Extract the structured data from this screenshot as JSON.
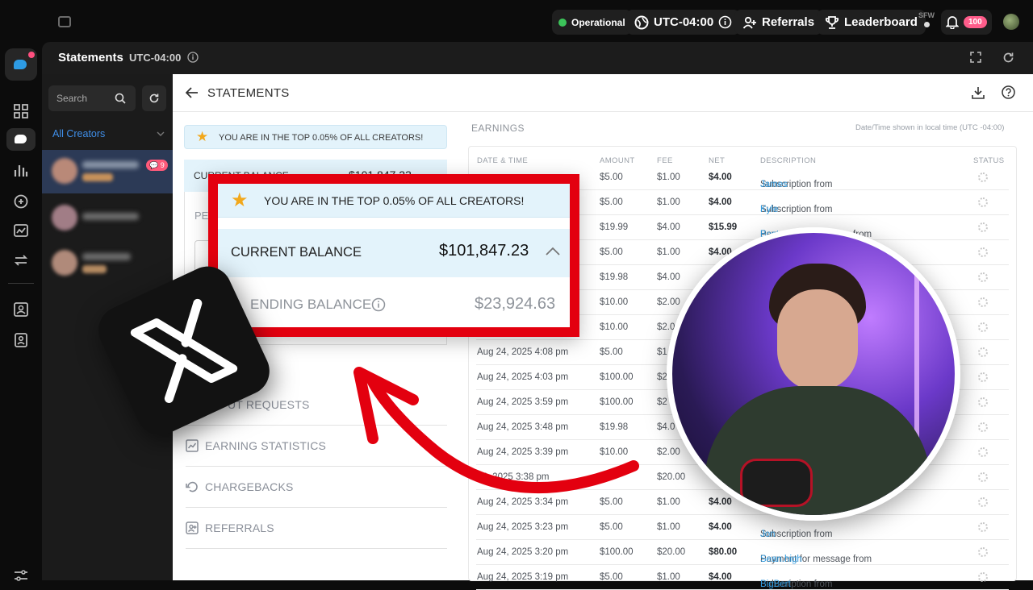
{
  "topbar": {
    "status": "Operational",
    "timezone": "UTC-04:00",
    "referrals": "Referrals",
    "leaderboard": "Leaderboard",
    "sfw": "SFW",
    "notif_count": "100"
  },
  "subheader": {
    "title": "Statements",
    "timezone": "UTC-04:00"
  },
  "creators": {
    "search_placeholder": "Search",
    "filter": "All Creators",
    "badge": "9"
  },
  "main": {
    "title": "STATEMENTS",
    "top_banner": "YOU ARE IN THE TOP 0.05% OF ALL CREATORS!",
    "current_balance_label": "CURRENT BALANCE",
    "current_balance_value": "$101,847.23",
    "pending_balance_label_partial": "PE",
    "menu": {
      "payout": "UT REQUESTS",
      "earning_stats": "EARNING STATISTICS",
      "chargebacks": "CHARGEBACKS",
      "referrals": "REFERRALS"
    }
  },
  "earnings": {
    "title": "EARNINGS",
    "note": "Date/Time shown in local time (UTC -04:00)",
    "columns": [
      "DATE & TIME",
      "AMOUNT",
      "FEE",
      "NET",
      "DESCRIPTION",
      "STATUS"
    ],
    "rows": [
      {
        "date": "",
        "amount": "$5.00",
        "fee": "$1.00",
        "net": "$4.00",
        "desc": "Subscription from ",
        "who": "James"
      },
      {
        "date": "",
        "amount": "$5.00",
        "fee": "$1.00",
        "net": "$4.00",
        "desc": "Subscription from ",
        "who": "Kyle"
      },
      {
        "date": "",
        "amount": "$19.99",
        "fee": "$4.00",
        "net": "$15.99",
        "desc": "Payment for message from ",
        "who": "Boston-guy69"
      },
      {
        "date": "",
        "amount": "$5.00",
        "fee": "$1.00",
        "net": "$4.00",
        "desc": "",
        "who": ""
      },
      {
        "date": "",
        "amount": "$19.98",
        "fee": "$4.00",
        "net": "",
        "desc": "",
        "who": ""
      },
      {
        "date": "",
        "amount": "$10.00",
        "fee": "$2.00",
        "net": "",
        "desc": "",
        "who": ""
      },
      {
        "date": "",
        "amount": "$10.00",
        "fee": "$2.0",
        "net": "",
        "desc": "",
        "who": ""
      },
      {
        "date": "Aug 24, 2025 4:08 pm",
        "amount": "$5.00",
        "fee": "$1",
        "net": "",
        "desc": "",
        "who": ""
      },
      {
        "date": "Aug 24, 2025 4:03 pm",
        "amount": "$100.00",
        "fee": "$2",
        "net": "",
        "desc": "",
        "who": ""
      },
      {
        "date": "Aug 24, 2025 3:59 pm",
        "amount": "$100.00",
        "fee": "$2",
        "net": "",
        "desc": "",
        "who": ""
      },
      {
        "date": "Aug 24, 2025 3:48 pm",
        "amount": "$19.98",
        "fee": "$4.0",
        "net": "",
        "desc": "",
        "who": ""
      },
      {
        "date": "Aug 24, 2025 3:39 pm",
        "amount": "$10.00",
        "fee": "$2.00",
        "net": "",
        "desc": "",
        "who": ""
      },
      {
        "date": "24, 2025 3:38 pm",
        "amount": "",
        "fee": "$20.00",
        "net": "",
        "desc": "",
        "who": ""
      },
      {
        "date": "Aug 24, 2025 3:34 pm",
        "amount": "$5.00",
        "fee": "$1.00",
        "net": "$4.00",
        "desc": "",
        "who": ""
      },
      {
        "date": "Aug 24, 2025 3:23 pm",
        "amount": "$5.00",
        "fee": "$1.00",
        "net": "$4.00",
        "desc": "Subscription from ",
        "who": "Jon"
      },
      {
        "date": "Aug 24, 2025 3:20 pm",
        "amount": "$100.00",
        "fee": "$20.00",
        "net": "$80.00",
        "desc": "Payment for message from ",
        "who": "Sean.high"
      },
      {
        "date": "Aug 24, 2025 3:19 pm",
        "amount": "$5.00",
        "fee": "$1.00",
        "net": "$4.00",
        "desc": "Subscription from ",
        "who": "BigBert"
      }
    ]
  },
  "zoom": {
    "banner": "YOU ARE IN THE TOP 0.05% OF ALL CREATORS!",
    "current_label": "CURRENT BALANCE",
    "current_value": "$101,847.23",
    "pending_label": "ENDING BALANCE",
    "pending_value": "$23,924.63"
  },
  "colors": {
    "accent_red": "#e3000f",
    "link_blue": "#2f9be0",
    "banner_blue": "#e3f3fb"
  }
}
